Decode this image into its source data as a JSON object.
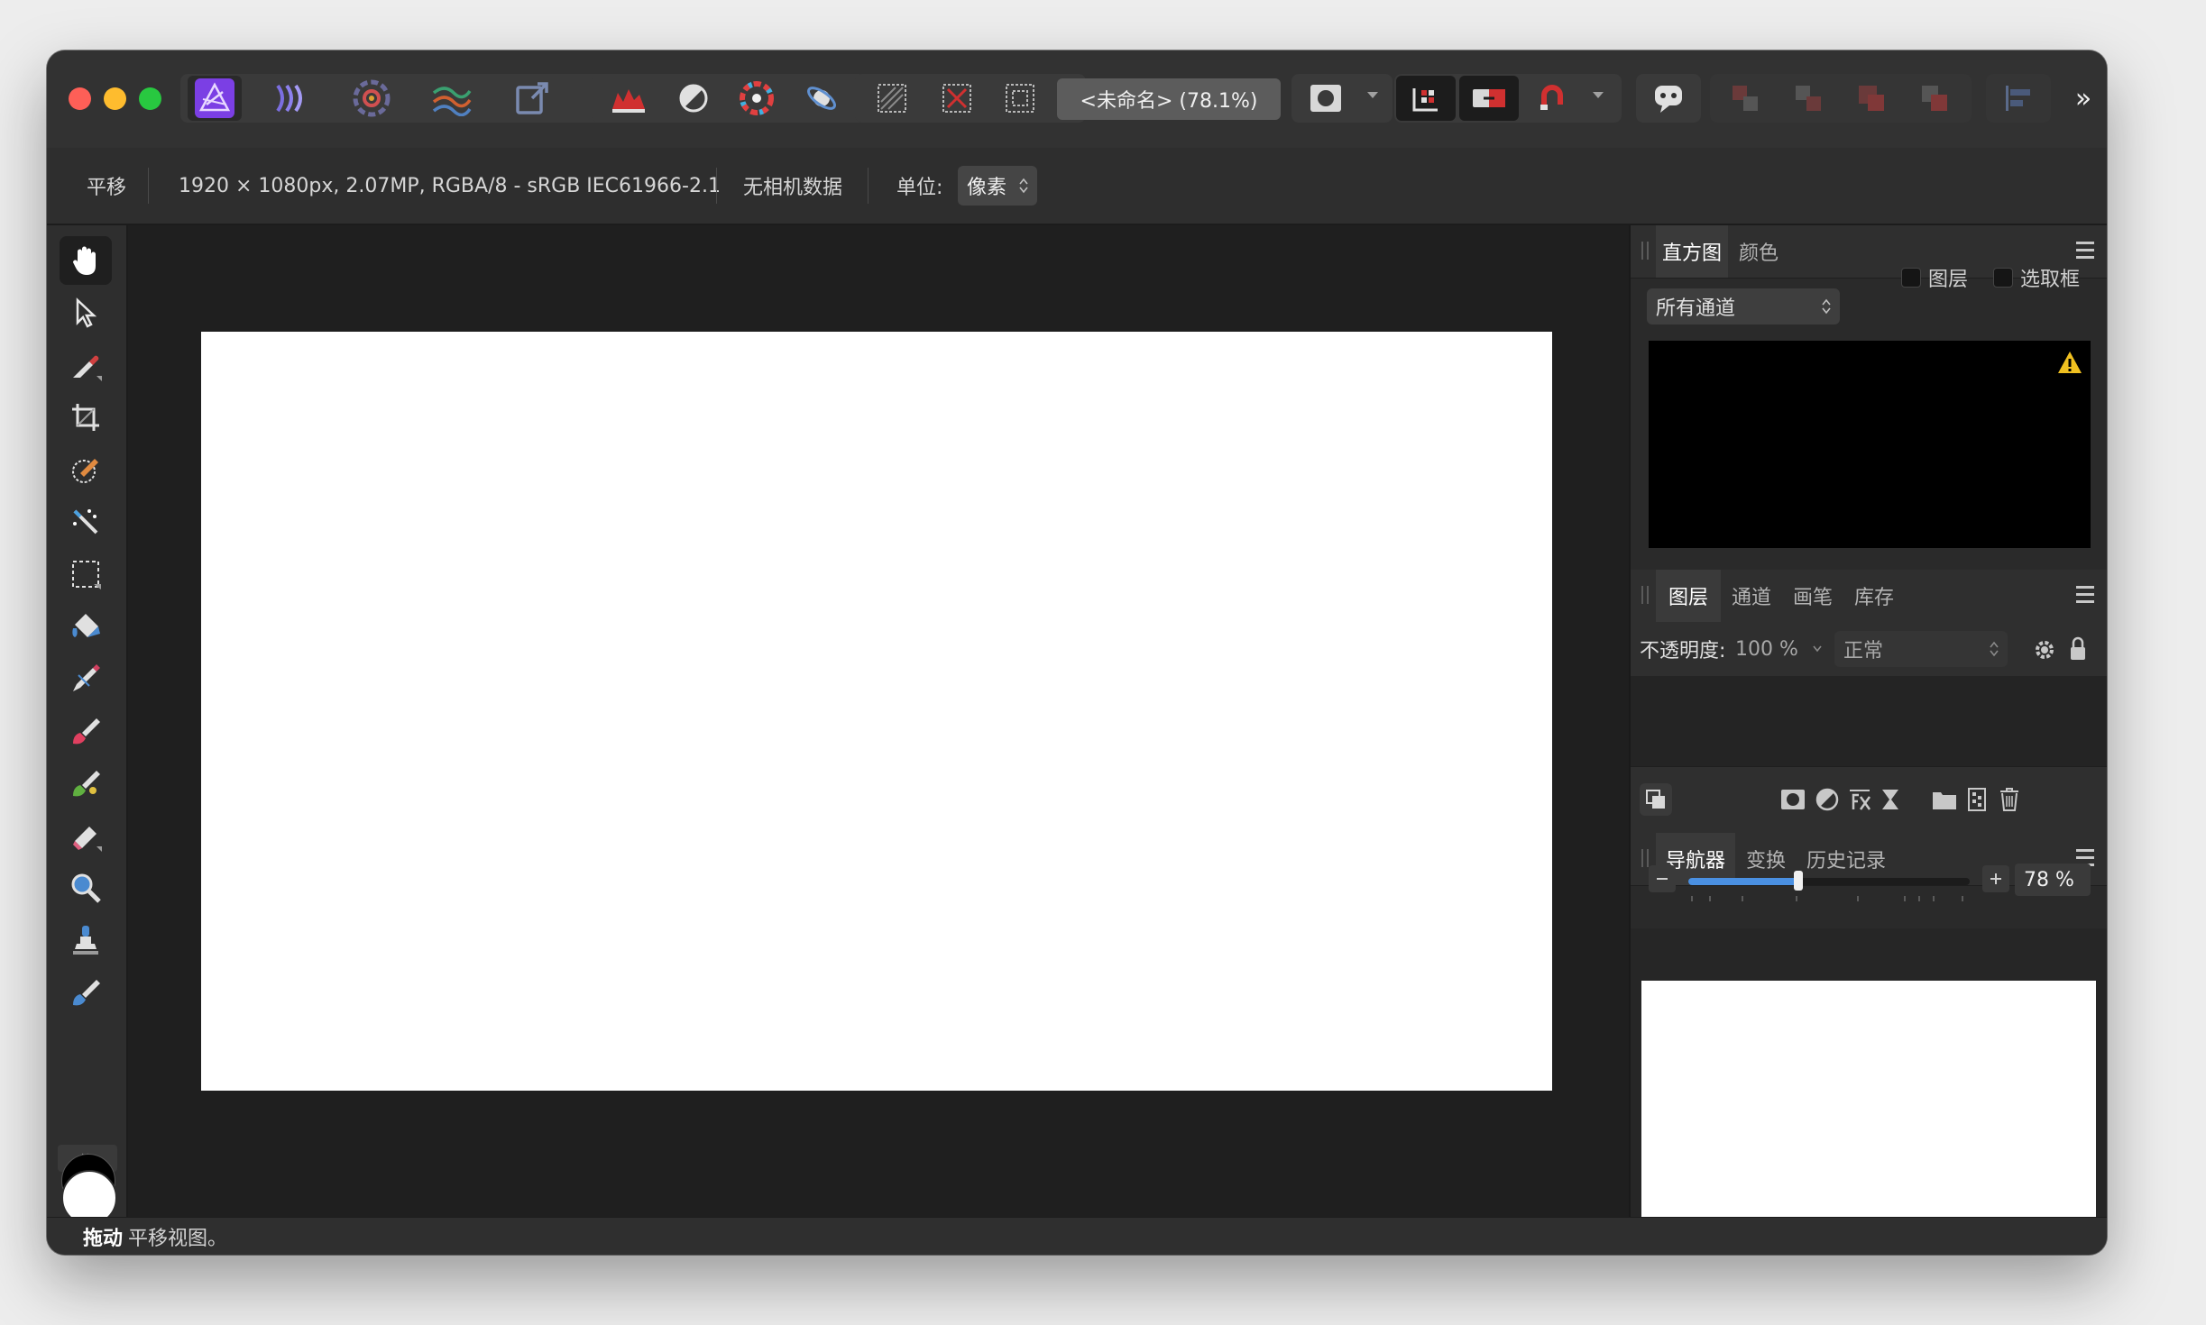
{
  "window": {
    "title": "<未命名> (78.1%)",
    "traffic_lights": [
      "#fe5f57",
      "#febc2e",
      "#28c840"
    ],
    "accent": "#7b3fe4"
  },
  "context_bar": {
    "tool_name": "平移",
    "doc_info": "1920 × 1080px, 2.07MP, RGBA/8 - sRGB IEC61966-2.1",
    "camera_data": "无相机数据",
    "unit_label": "单位:",
    "unit_value": "像素"
  },
  "tools": [
    "view-hand-icon",
    "move-arrow-icon",
    "color-picker-icon",
    "crop-icon",
    "selection-brush-icon",
    "magic-wand-icon",
    "marquee-icon",
    "flood-fill-icon",
    "pencil-icon",
    "paint-brush-icon",
    "mixer-brush-icon",
    "eraser-icon",
    "zoom-magnifier-icon",
    "clone-stamp-icon",
    "retouch-brush-icon"
  ],
  "toolbar_more": "»",
  "histogram_panel": {
    "tabs": [
      "直方图",
      "颜色"
    ],
    "channel_select": "所有通道",
    "check_layer": "图层",
    "check_selection": "选取框"
  },
  "layers_panel": {
    "tabs": [
      "图层",
      "通道",
      "画笔",
      "库存"
    ],
    "opacity_label": "不透明度:",
    "opacity_value": "100 %",
    "blend_mode": "正常"
  },
  "navigator_panel": {
    "tabs": [
      "导航器",
      "变换",
      "历史记录"
    ],
    "zoom_value": "78 %",
    "zoom_fraction": 0.39
  },
  "status": {
    "bold": "拖动",
    "text": "平移视图。"
  }
}
